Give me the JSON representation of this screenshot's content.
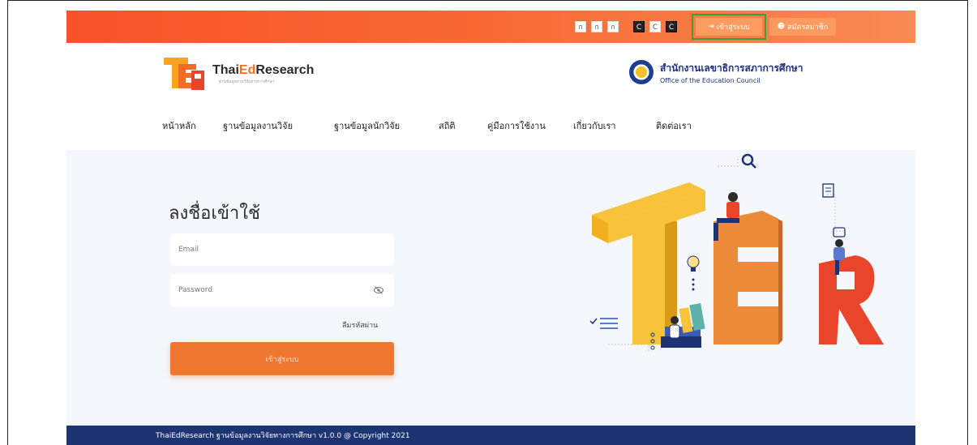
{
  "topbar": {
    "font_size_buttons": [
      "ก",
      "ก",
      "ก"
    ],
    "contrast_buttons": [
      "C",
      "C",
      "C"
    ],
    "login_label": "เข้าสู่ระบบ",
    "register_label": "สมัครสมาชิก"
  },
  "header": {
    "logo_prefix": "Thai",
    "logo_ed": "Ed",
    "logo_suffix": "Research",
    "logo_subtitle": "ฐานข้อมูลงานวิจัยทางการศึกษา",
    "office_th": "สำนักงานเลขาธิการสภาการศึกษา",
    "office_en": "Office of the Education Council"
  },
  "nav": {
    "items": [
      {
        "label": "หน้าหลัก"
      },
      {
        "label": "ฐานข้อมูลงานวิจัย"
      },
      {
        "label": "ฐานข้อมูลนักวิจัย"
      },
      {
        "label": "สถิติ"
      },
      {
        "label": "คู่มือการใช้งาน"
      },
      {
        "label": "เกี่ยวกับเรา"
      },
      {
        "label": "ติดต่อเรา"
      }
    ]
  },
  "login": {
    "title": "ลงชื่อเข้าใช้",
    "email_placeholder": "Email",
    "password_placeholder": "Password",
    "forgot_label": "ลืมรหัสผ่าน",
    "submit_label": "เข้าสู่ระบบ"
  },
  "footer": {
    "text": "ThaiEdResearch ฐานข้อมูลงานวิจัยทางการศึกษา v1.0.0 @ Copyright 2021"
  },
  "colors": {
    "brand_orange": "#ef7730",
    "footer_blue": "#1d3473",
    "highlight_green": "#3b9f33"
  }
}
